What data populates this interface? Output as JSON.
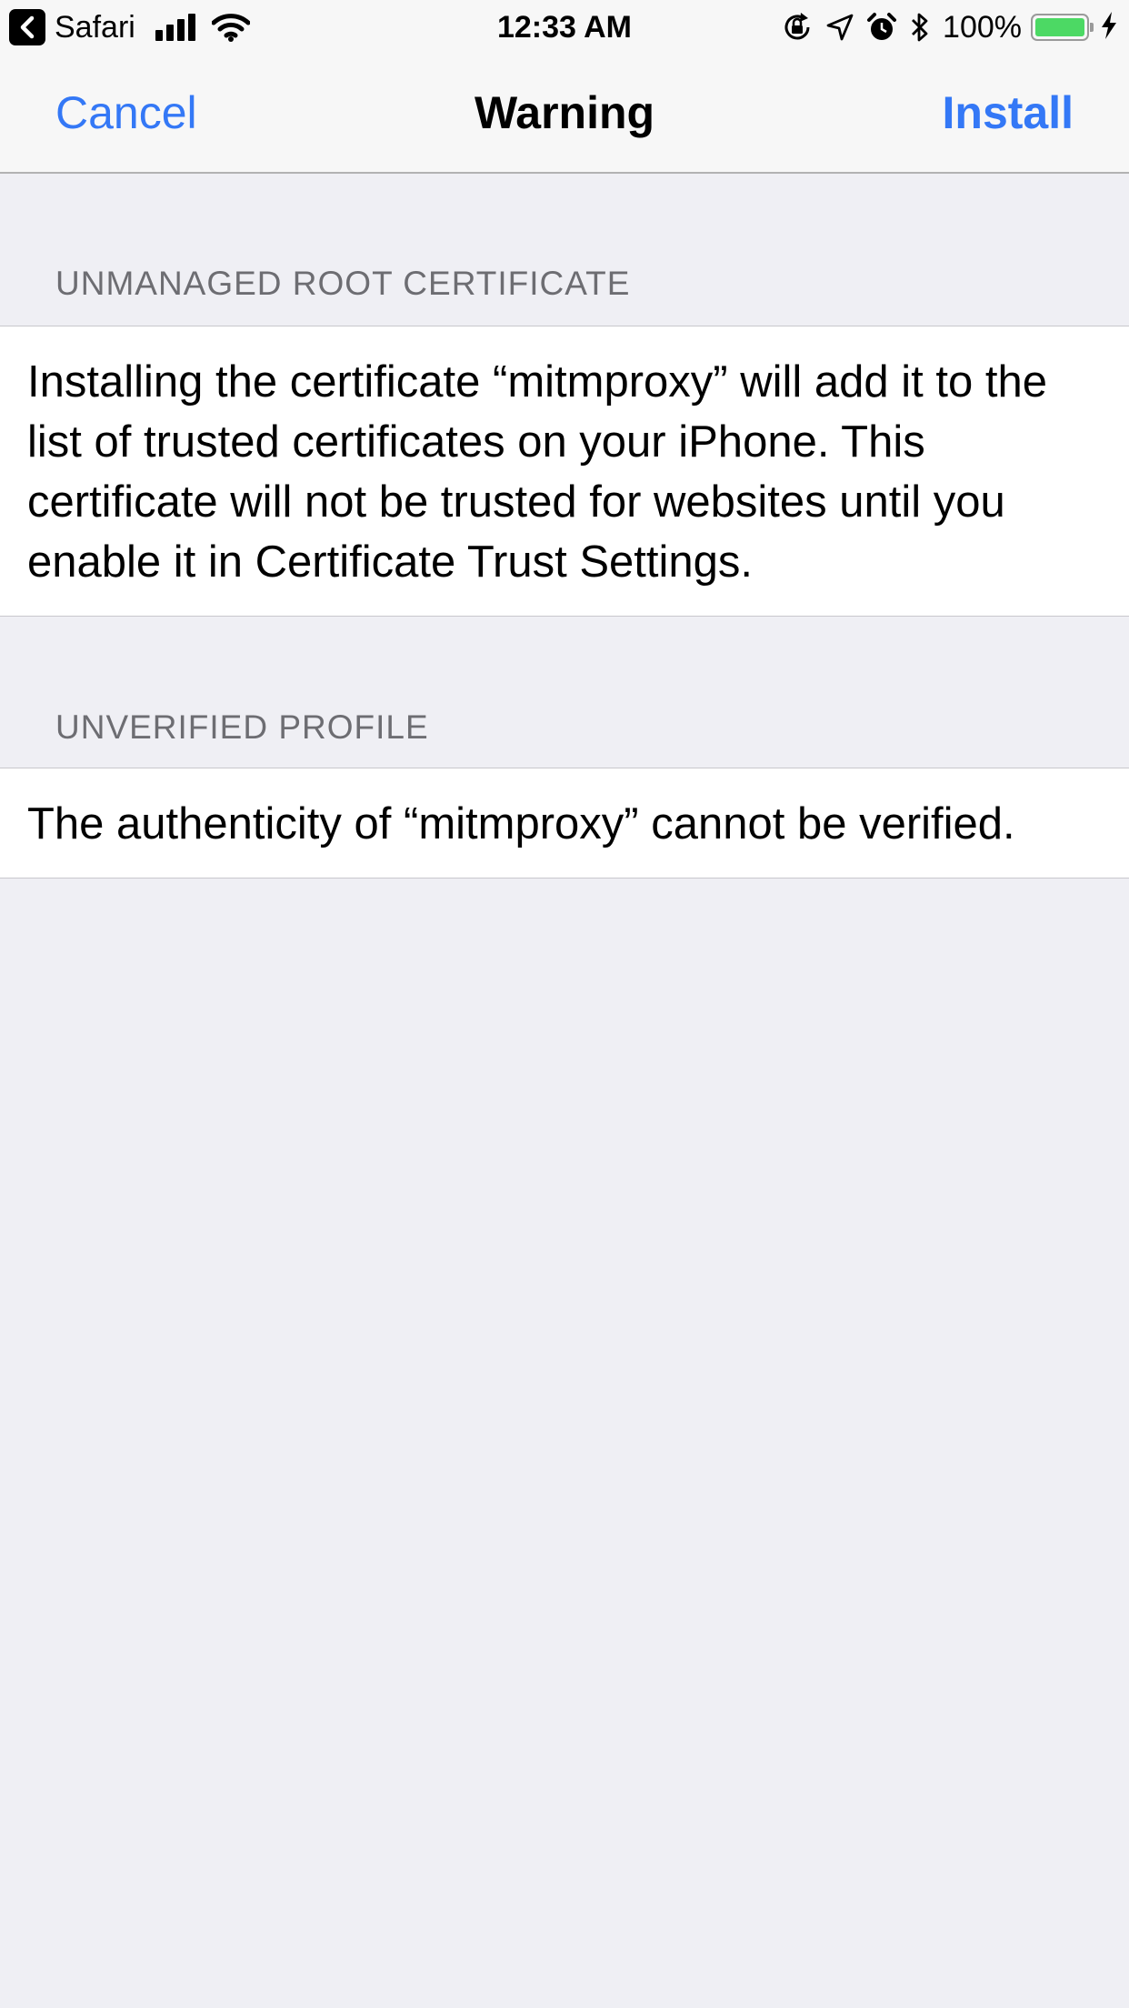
{
  "status_bar": {
    "back_app": "Safari",
    "time": "12:33 AM",
    "battery_percent": "100%",
    "battery_level": 1.0,
    "icons": [
      "back-arrow-icon",
      "signal-bars-icon",
      "wifi-icon",
      "orientation-lock-icon",
      "location-arrow-icon",
      "alarm-icon",
      "bluetooth-icon",
      "battery-icon",
      "charging-bolt-icon"
    ],
    "battery_color": "#4cd964"
  },
  "nav": {
    "cancel_label": "Cancel",
    "title": "Warning",
    "install_label": "Install",
    "accent_color": "#3478f6"
  },
  "sections": [
    {
      "header": "UNMANAGED ROOT CERTIFICATE",
      "body": "Installing the certificate “mitmproxy” will add it to the list of trusted certificates on your iPhone. This certificate will not be trusted for websites until you enable it in Certificate Trust Settings."
    },
    {
      "header": "UNVERIFIED PROFILE",
      "body": "The authenticity of “mitmproxy” cannot be verified."
    }
  ]
}
